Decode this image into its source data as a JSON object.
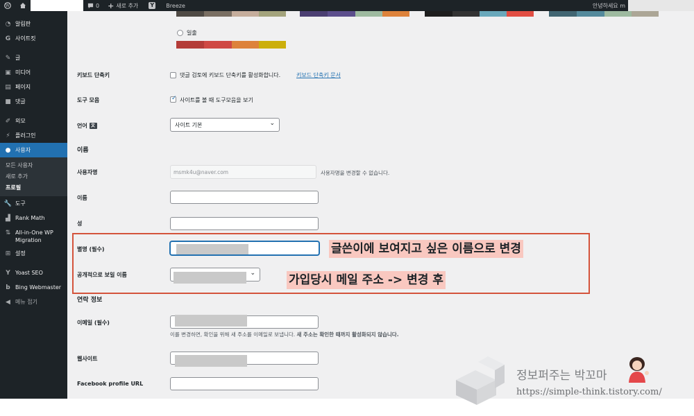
{
  "admin_bar": {
    "comments_count": "0",
    "new_label": "새로 추가",
    "plugin_label": "Breeze",
    "greeting": "안녕하세요 m"
  },
  "sidebar": {
    "items": [
      {
        "icon": "gauge-icon",
        "label": "알림판"
      },
      {
        "icon": "g-icon",
        "label": "사이트킷"
      },
      {
        "icon": "pin-icon",
        "label": "글"
      },
      {
        "icon": "media-icon",
        "label": "미디어"
      },
      {
        "icon": "page-icon",
        "label": "페이지"
      },
      {
        "icon": "comment-icon",
        "label": "댓글"
      },
      {
        "icon": "brush-icon",
        "label": "외모"
      },
      {
        "icon": "plugin-icon",
        "label": "플러그인"
      },
      {
        "icon": "user-icon",
        "label": "사용자"
      },
      {
        "icon": "wrench-icon",
        "label": "도구"
      },
      {
        "icon": "rankmath-icon",
        "label": "Rank Math"
      },
      {
        "icon": "migration-icon",
        "label": "All-in-One WP Migration"
      },
      {
        "icon": "settings-icon",
        "label": "설정"
      },
      {
        "icon": "yoast-icon",
        "label": "Yoast SEO"
      },
      {
        "icon": "bing-icon",
        "label": "Bing Webmaster"
      },
      {
        "icon": "collapse-icon",
        "label": "메뉴 접기"
      }
    ],
    "submenu": [
      "모든 사용자",
      "새로 추가",
      "프로필"
    ]
  },
  "form": {
    "sunrise_label": "일출",
    "keyboard_label": "키보드 단축키",
    "keyboard_text": "댓글 검토에 키보드 단축키를 활성화합니다.",
    "keyboard_link": "키보드 단축키 문서",
    "toolbar_label": "도구 모음",
    "toolbar_text": "사이트를 볼 때 도구모음을 보기",
    "language_label": "언어",
    "language_value": "사이트 기본",
    "name_section": "이름",
    "username_label": "사용자명",
    "username_value": "msmk4u@naver.com",
    "username_note": "사용자명을 변경할 수 없습니다.",
    "first_name_label": "이름",
    "last_name_label": "성",
    "nickname_label": "별명 (필수)",
    "display_name_label": "공개적으로 보일 이름",
    "contact_section": "연락 정보",
    "email_label": "이메일 (필수)",
    "email_note": "이를 변경하면, 확인을 위해 새 주소를 이메일로 보냅니다.",
    "email_note_bold": "새 주소는 확인한 때까지 활성화되지 않습니다.",
    "website_label": "웹사이트",
    "facebook_label": "Facebook profile URL"
  },
  "annotations": {
    "note1": "글쓴이에 보여지고 싶은 이름으로 변경",
    "note2": "가입당시 메일 주소 -> 변경 후"
  },
  "watermark": {
    "title": "정보퍼주는 박꼬마",
    "url": "https://simple-think.tistory.com/"
  },
  "colors": {
    "admin_bar": "#1d2327",
    "accent": "#2271b1",
    "callout_border": "#d4533b",
    "note_bg": "#f9c8c0",
    "sunrise_palette": [
      "#b43c38",
      "#cf4944",
      "#dd823b",
      "#ccaf0b"
    ]
  }
}
